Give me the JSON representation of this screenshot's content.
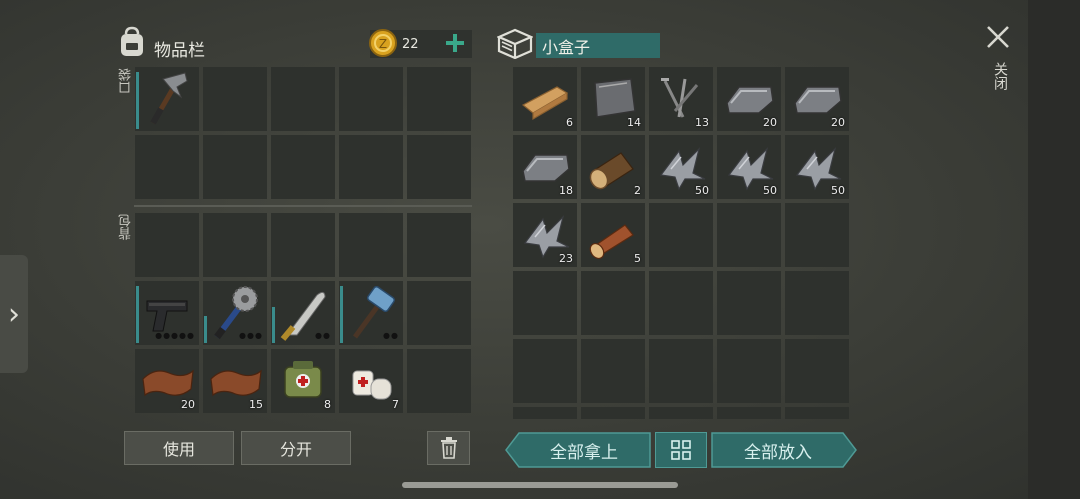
{
  "inventory": {
    "title": "物品栏",
    "coins": "22",
    "pockets_label": "口袋",
    "backpack_label": "背包",
    "pocket_slots": [
      {
        "item": "hatchet",
        "qty": "",
        "durability": 0.95
      },
      {
        "item": "",
        "qty": ""
      },
      {
        "item": "",
        "qty": ""
      },
      {
        "item": "",
        "qty": ""
      },
      {
        "item": "",
        "qty": ""
      },
      {
        "item": "",
        "qty": ""
      },
      {
        "item": "",
        "qty": ""
      },
      {
        "item": "",
        "qty": ""
      },
      {
        "item": "",
        "qty": ""
      },
      {
        "item": "",
        "qty": ""
      }
    ],
    "backpack_slots": [
      {
        "item": "",
        "qty": ""
      },
      {
        "item": "",
        "qty": ""
      },
      {
        "item": "",
        "qty": ""
      },
      {
        "item": "",
        "qty": ""
      },
      {
        "item": "",
        "qty": ""
      },
      {
        "item": "pistol",
        "qty": "",
        "durability": 0.95,
        "dots": "●●●●●"
      },
      {
        "item": "saw-mace",
        "qty": "",
        "durability": 0.45,
        "dots": "●●●"
      },
      {
        "item": "machete",
        "qty": "",
        "durability": 0.6,
        "dots": "●●"
      },
      {
        "item": "sledgehammer",
        "qty": "",
        "durability": 0.95,
        "dots": "●●"
      },
      {
        "item": "",
        "qty": ""
      },
      {
        "item": "leather",
        "qty": "20"
      },
      {
        "item": "leather",
        "qty": "15"
      },
      {
        "item": "medkit-bag",
        "qty": "8"
      },
      {
        "item": "bandage",
        "qty": "7"
      },
      {
        "item": "",
        "qty": ""
      }
    ],
    "use_label": "使用",
    "split_label": "分开"
  },
  "container": {
    "title": "小盒子",
    "close_label": "关闭",
    "slots": [
      {
        "item": "plank",
        "qty": "6"
      },
      {
        "item": "metal-plate",
        "qty": "14"
      },
      {
        "item": "nails",
        "qty": "13"
      },
      {
        "item": "iron-ingot",
        "qty": "20"
      },
      {
        "item": "iron-ingot",
        "qty": "20"
      },
      {
        "item": "iron-ingot",
        "qty": "18"
      },
      {
        "item": "log",
        "qty": "2"
      },
      {
        "item": "metal-scrap",
        "qty": "50"
      },
      {
        "item": "metal-scrap",
        "qty": "50"
      },
      {
        "item": "metal-scrap",
        "qty": "50"
      },
      {
        "item": "metal-scrap",
        "qty": "23"
      },
      {
        "item": "wood-log",
        "qty": "5"
      },
      {
        "item": "",
        "qty": ""
      },
      {
        "item": "",
        "qty": ""
      },
      {
        "item": "",
        "qty": ""
      },
      {
        "item": "",
        "qty": ""
      },
      {
        "item": "",
        "qty": ""
      },
      {
        "item": "",
        "qty": ""
      },
      {
        "item": "",
        "qty": ""
      },
      {
        "item": "",
        "qty": ""
      },
      {
        "item": "",
        "qty": ""
      },
      {
        "item": "",
        "qty": ""
      },
      {
        "item": "",
        "qty": ""
      },
      {
        "item": "",
        "qty": ""
      },
      {
        "item": "",
        "qty": ""
      },
      {
        "item": "",
        "qty": ""
      },
      {
        "item": "",
        "qty": ""
      },
      {
        "item": "",
        "qty": ""
      },
      {
        "item": "",
        "qty": ""
      },
      {
        "item": "",
        "qty": ""
      }
    ],
    "take_all_label": "全部拿上",
    "put_all_label": "全部放入"
  },
  "colors": {
    "teal": "#2f6b68",
    "durability": "#3a8c8c",
    "coin": "#d9a21f"
  }
}
